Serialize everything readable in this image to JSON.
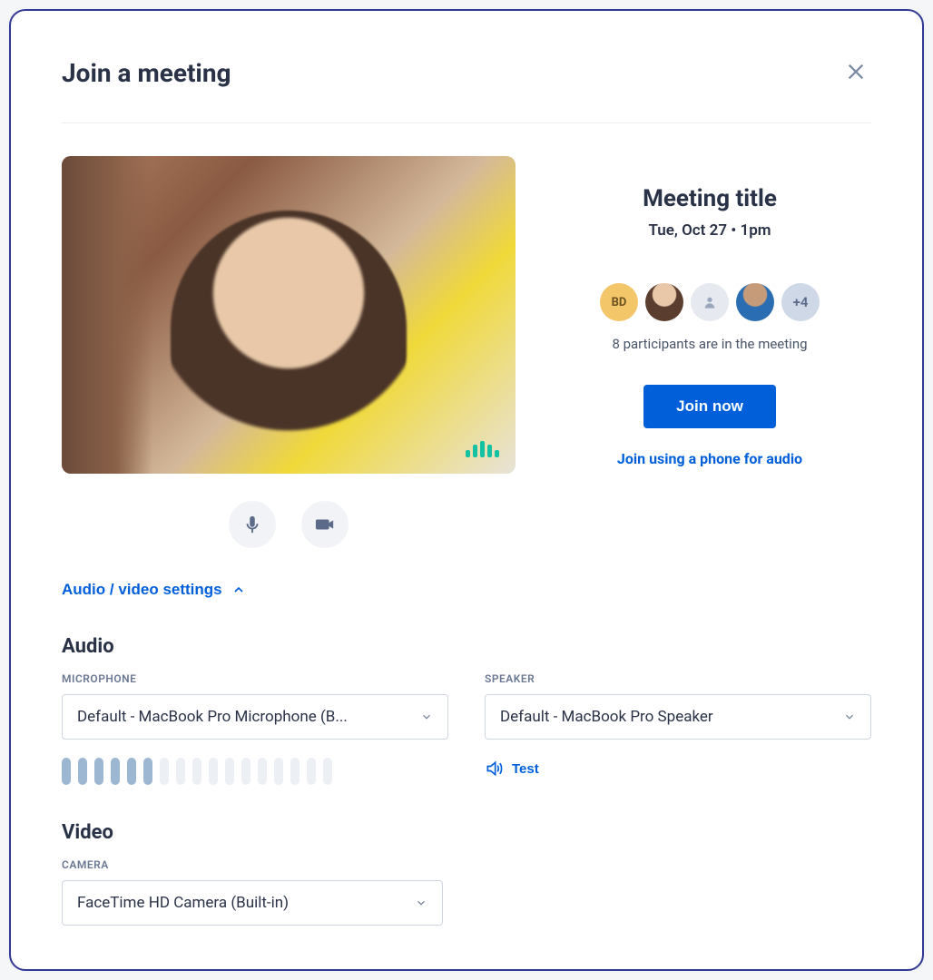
{
  "modal": {
    "title": "Join a meeting"
  },
  "meeting": {
    "title": "Meeting title",
    "time": "Tue, Oct 27 • 1pm",
    "participants_text": "8 participants are in the meeting",
    "avatars": {
      "initials": "BD",
      "more": "+4"
    },
    "join_button": "Join now",
    "phone_link": "Join using a phone for audio"
  },
  "settings": {
    "toggle_label": "Audio / video settings",
    "audio": {
      "heading": "Audio",
      "microphone_label": "MICROPHONE",
      "microphone_value": "Default - MacBook Pro Microphone (B...",
      "speaker_label": "SPEAKER",
      "speaker_value": "Default - MacBook Pro Speaker",
      "test_label": "Test",
      "mic_level_active": 6,
      "mic_level_total": 17
    },
    "video": {
      "heading": "Video",
      "camera_label": "CAMERA",
      "camera_value": "FaceTime HD Camera (Built-in)"
    }
  }
}
